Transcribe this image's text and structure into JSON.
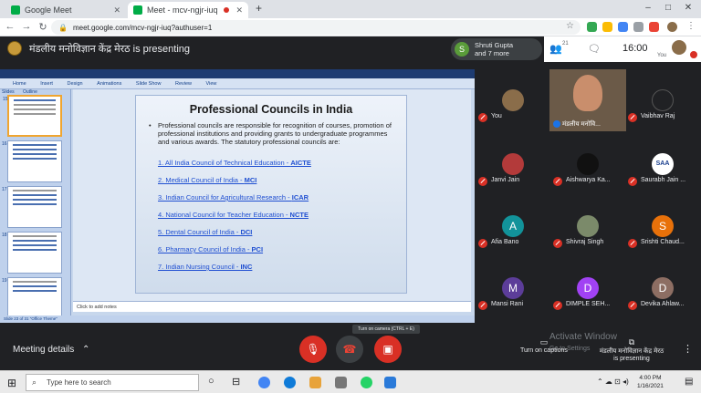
{
  "browser": {
    "tabs": [
      {
        "title": "Google Meet",
        "active": false
      },
      {
        "title": "Meet - mcv-ngjr-iuq",
        "active": true
      }
    ],
    "url": "meet.google.com/mcv-ngjr-iuq?authuser=1",
    "new_tab_label": "+"
  },
  "meet": {
    "presenting_banner": "मंडलीय मनोविज्ञान केंद्र मेरठ is presenting",
    "chip_initial": "S",
    "chip_line1": "Shruti Gupta",
    "chip_line2": "and 7 more",
    "people_count": "21",
    "time": "16:00",
    "you_label": "You",
    "self_tile_name": "मंडलीय मनोवि..."
  },
  "slide": {
    "title": "Professional Councils in India",
    "intro": "Professional councils are responsible for recognition of courses, promotion of professional institutions and providing grants to undergraduate programmes and various awards. The statutory professional councils are:",
    "councils": [
      {
        "text": "1. All India Council of Technical Education - ",
        "abbr": "AICTE"
      },
      {
        "text": "2. Medical Council of India - ",
        "abbr": "MCI"
      },
      {
        "text": "3. Indian Council for Agricultural Research - ",
        "abbr": "ICAR"
      },
      {
        "text": "4. National Council for Teacher Education - ",
        "abbr": "NCTE"
      },
      {
        "text": "5. Dental Council of India - ",
        "abbr": "DCI"
      },
      {
        "text": "6. Pharmacy Council of India - ",
        "abbr": "PCI"
      },
      {
        "text": "7. Indian Nursing Council - ",
        "abbr": "INC"
      }
    ],
    "notes_placeholder": "Click to add notes",
    "ribbon": [
      "Home",
      "Insert",
      "Design",
      "Animations",
      "Slide Show",
      "Review",
      "View"
    ],
    "panel_tabs": [
      "Slides",
      "Outline"
    ],
    "status": "Slide 23 of 31   \"Office Theme\"",
    "thumb_numbers": [
      "15",
      "16",
      "17",
      "18",
      "19"
    ]
  },
  "participants": [
    {
      "name": "You",
      "initial": "",
      "color": "#8a6d4a"
    },
    {
      "name": "Vaibhav Raj",
      "initial": "",
      "color": "#202124"
    },
    {
      "name": "Janvi Jain",
      "initial": "",
      "color": "#b33a3a"
    },
    {
      "name": "Aishwarya Ka...",
      "initial": "",
      "color": "#111111"
    },
    {
      "name": "Saurabh Jain ...",
      "initial": "SAA",
      "color": "#ffffff"
    },
    {
      "name": "Afia Bano",
      "initial": "A",
      "color": "#12939a"
    },
    {
      "name": "Shivraj Singh",
      "initial": "",
      "color": "#7b8a6a"
    },
    {
      "name": "Srishti Chaud...",
      "initial": "S",
      "color": "#e8710a"
    },
    {
      "name": "Mansi Rani",
      "initial": "M",
      "color": "#5c3d99"
    },
    {
      "name": "DIMPLE SEH...",
      "initial": "D",
      "color": "#a142f4"
    },
    {
      "name": "Devika Ahlaw...",
      "initial": "D",
      "color": "#8d6e63"
    }
  ],
  "controls": {
    "meeting_details": "Meeting details",
    "turn_on_captions": "Turn on captions",
    "tooltip": "Turn on camera (CTRL + E)",
    "presenting_name": "मंडलीय मनोविज्ञान केंद्र मेरठ",
    "presenting_label": "is presenting",
    "activate_line1": "Activate Window",
    "activate_line2": "Go to Settings"
  },
  "taskbar": {
    "search_placeholder": "Type here to search",
    "time": "4:00 PM",
    "date": "1/16/2021"
  }
}
